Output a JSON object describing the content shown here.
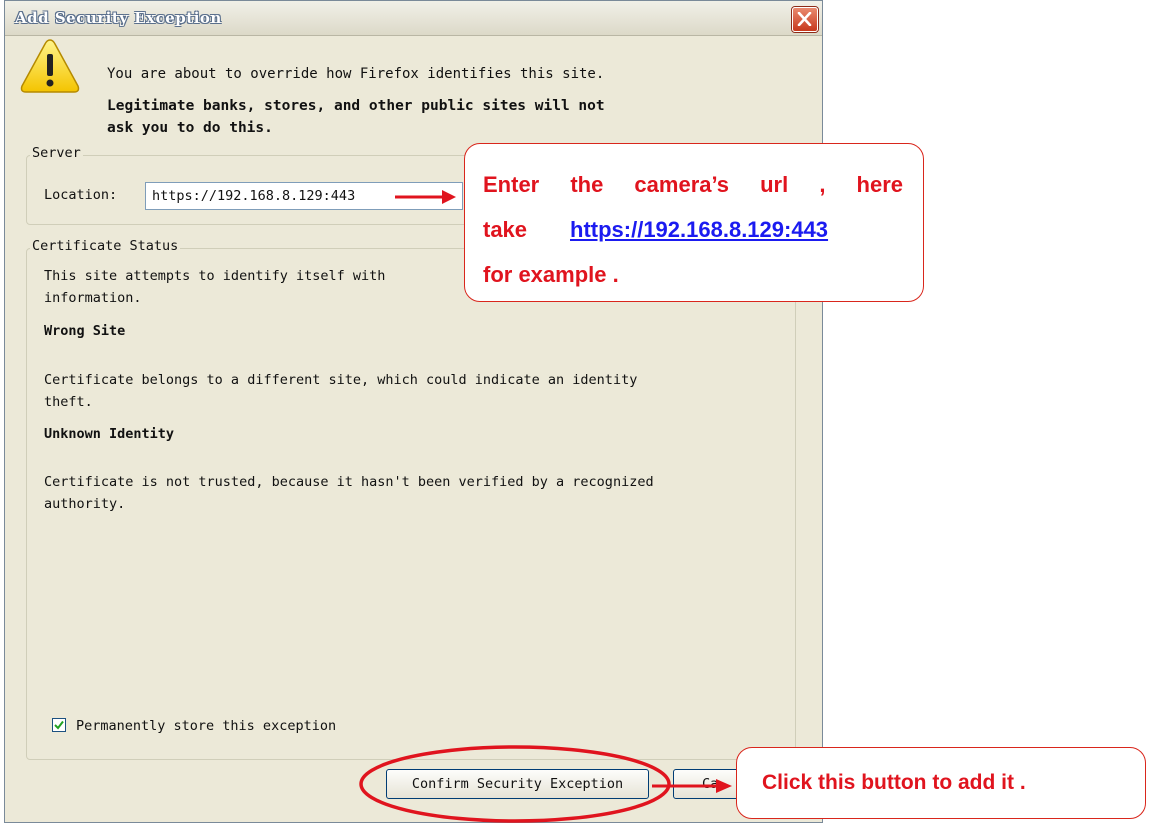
{
  "window": {
    "title": "Add Security Exception",
    "close_icon": "close-icon"
  },
  "intro": {
    "line1": "You are about to override how Firefox identifies this site.",
    "warning_line1": "Legitimate banks, stores, and other public sites will not",
    "warning_line2": "ask you to do this.",
    "icon": "warning-icon"
  },
  "server": {
    "group_label": "Server",
    "location_label": "Location:",
    "location_value": "https://192.168.8.129:443"
  },
  "certificate": {
    "group_label": "Certificate Status",
    "line1": "This site attempts to identify itself with",
    "line2": "information.",
    "wrong_site_heading": "Wrong Site",
    "wrong_site_text1": "Certificate belongs to a different site, which could indicate an identity",
    "wrong_site_text2": "theft.",
    "unknown_heading": "Unknown Identity",
    "unknown_text1": "Certificate is not trusted, because it hasn't been verified by a recognized",
    "unknown_text2": "authority."
  },
  "permanent": {
    "checked": true,
    "label": "Permanently store this exception"
  },
  "buttons": {
    "confirm": "Confirm Security Exception",
    "cancel": "Ca"
  },
  "callouts": {
    "url_line1": "Enter the camera’s url , here",
    "url_line2_prefix": "take",
    "url_link": "https://192.168.8.129:443",
    "url_line3": "for example .",
    "button_hint": "Click this button to add it ."
  },
  "colors": {
    "annotation_red": "#e0141e",
    "link_blue": "#1b1bf0",
    "dialog_bg": "#ece9d8"
  }
}
